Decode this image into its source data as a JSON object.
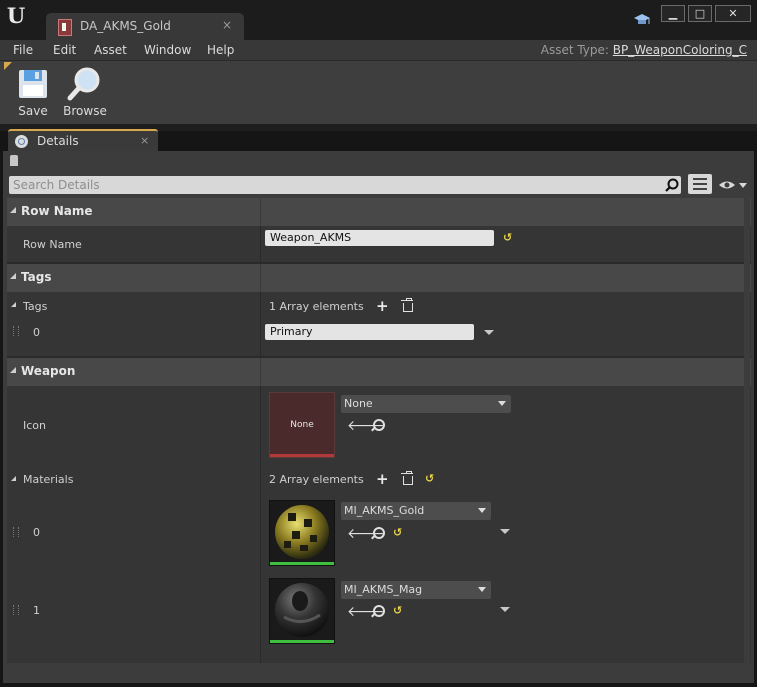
{
  "window": {
    "tab_title": "DA_AKMS_Gold",
    "tab_close": "×",
    "minimize": "▁",
    "maximize": "□",
    "close": "✕"
  },
  "menu": {
    "items": [
      "File",
      "Edit",
      "Asset",
      "Window",
      "Help"
    ],
    "asset_type_label": "Asset Type:",
    "asset_type_value": "BP_WeaponColoring_C"
  },
  "toolbar": {
    "save_label": "Save",
    "browse_label": "Browse"
  },
  "details": {
    "tab_label": "Details",
    "tab_close": "×",
    "search_placeholder": "Search Details"
  },
  "categories": {
    "row_name": {
      "title": "Row Name",
      "label": "Row Name",
      "value": "Weapon_AKMS"
    },
    "tags": {
      "title": "Tags",
      "label": "Tags",
      "array_count": "1 Array elements",
      "elements": [
        {
          "index": "0",
          "value": "Primary"
        }
      ]
    },
    "weapon": {
      "title": "Weapon",
      "icon_label": "Icon",
      "icon_thumb_text": "None",
      "icon_value": "None",
      "materials_label": "Materials",
      "materials_count": "2 Array elements",
      "materials": [
        {
          "index": "0",
          "value": "MI_AKMS_Gold"
        },
        {
          "index": "1",
          "value": "MI_AKMS_Mag"
        }
      ]
    }
  },
  "colors": {
    "accent": "#d7a84a",
    "reset_arrow": "#e8d24a",
    "texture_bar": "#b03a3a",
    "material_bar": "#3fbf3f"
  },
  "icons": {
    "logo": "unreal-engine-logo",
    "save": "floppy-disk-icon",
    "browse": "magnifier-icon",
    "search": "search-icon",
    "view_options": "list-view-icon",
    "visibility": "eye-icon"
  }
}
